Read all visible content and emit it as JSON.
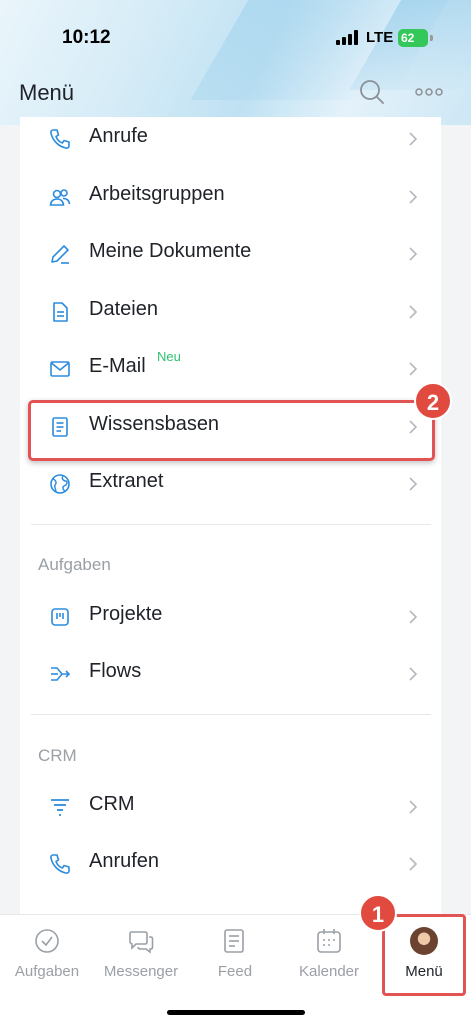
{
  "status_bar": {
    "time": "10:12",
    "network": "LTE",
    "battery": "62"
  },
  "header": {
    "title": "Menü"
  },
  "menu": {
    "items": [
      {
        "label": "Anrufe",
        "icon": "phone-icon"
      },
      {
        "label": "Arbeitsgruppen",
        "icon": "group-icon"
      },
      {
        "label": "Meine Dokumente",
        "icon": "pen-icon"
      },
      {
        "label": "Dateien",
        "icon": "file-icon"
      },
      {
        "label": "E-Mail",
        "icon": "mail-icon",
        "badge": "Neu"
      },
      {
        "label": "Wissensbasen",
        "icon": "book-icon"
      },
      {
        "label": "Extranet",
        "icon": "globe-icon"
      }
    ],
    "sections": [
      {
        "title": "Aufgaben",
        "items": [
          {
            "label": "Projekte",
            "icon": "project-icon"
          },
          {
            "label": "Flows",
            "icon": "flows-icon"
          }
        ]
      },
      {
        "title": "CRM",
        "items": [
          {
            "label": "CRM",
            "icon": "crm-icon"
          },
          {
            "label": "Anrufen",
            "icon": "phone-icon"
          }
        ]
      }
    ]
  },
  "annotations": {
    "step1": "1",
    "step2": "2"
  },
  "tab_bar": {
    "tabs": [
      {
        "label": "Aufgaben",
        "icon": "check-circle-icon"
      },
      {
        "label": "Messenger",
        "icon": "chat-icon"
      },
      {
        "label": "Feed",
        "icon": "feed-icon"
      },
      {
        "label": "Kalender",
        "icon": "calendar-icon"
      },
      {
        "label": "Menü",
        "icon": "avatar",
        "active": true
      }
    ]
  },
  "colors": {
    "accent": "#2b8cde",
    "highlight": "#e25353",
    "new_badge": "#2fc26e"
  }
}
